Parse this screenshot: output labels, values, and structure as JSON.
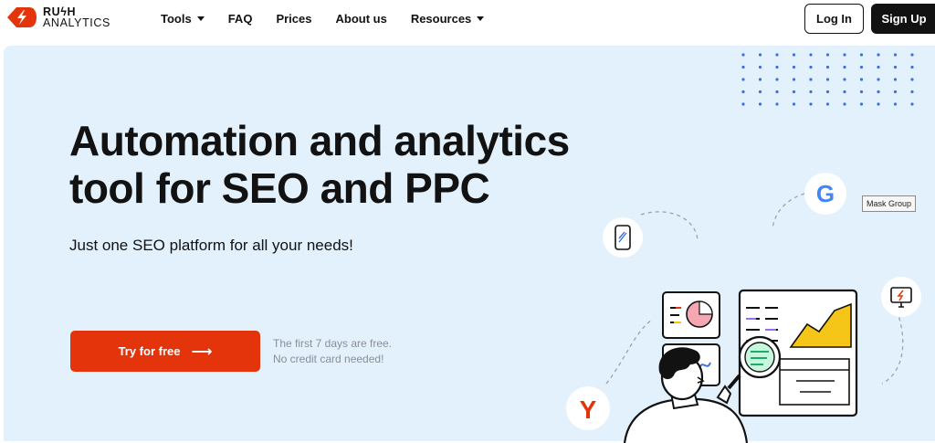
{
  "brand": {
    "line1": "RUϟH",
    "line2": "ANALYTICS",
    "accent_color": "#e3340c"
  },
  "nav": {
    "items": [
      {
        "label": "Tools",
        "dropdown": true
      },
      {
        "label": "FAQ",
        "dropdown": false
      },
      {
        "label": "Prices",
        "dropdown": false
      },
      {
        "label": "About us",
        "dropdown": false
      },
      {
        "label": "Resources",
        "dropdown": true
      }
    ]
  },
  "auth": {
    "login_label": "Log In",
    "signup_label": "Sign Up"
  },
  "hero": {
    "title": "Automation and analytics tool for SEO and PPC",
    "subtitle": "Just one SEO platform for all your needs!",
    "cta_label": "Try for free",
    "cta_icon": "arrow-right-icon",
    "note_line1": "The first 7 days are free.",
    "note_line2": "No credit card needed!",
    "background_color": "#e2f1fc"
  },
  "tooltip": {
    "text": "Mask Group"
  },
  "illustration": {
    "icons": [
      "google-icon",
      "yandex-icon",
      "mobile-icon",
      "monitor-icon"
    ]
  }
}
